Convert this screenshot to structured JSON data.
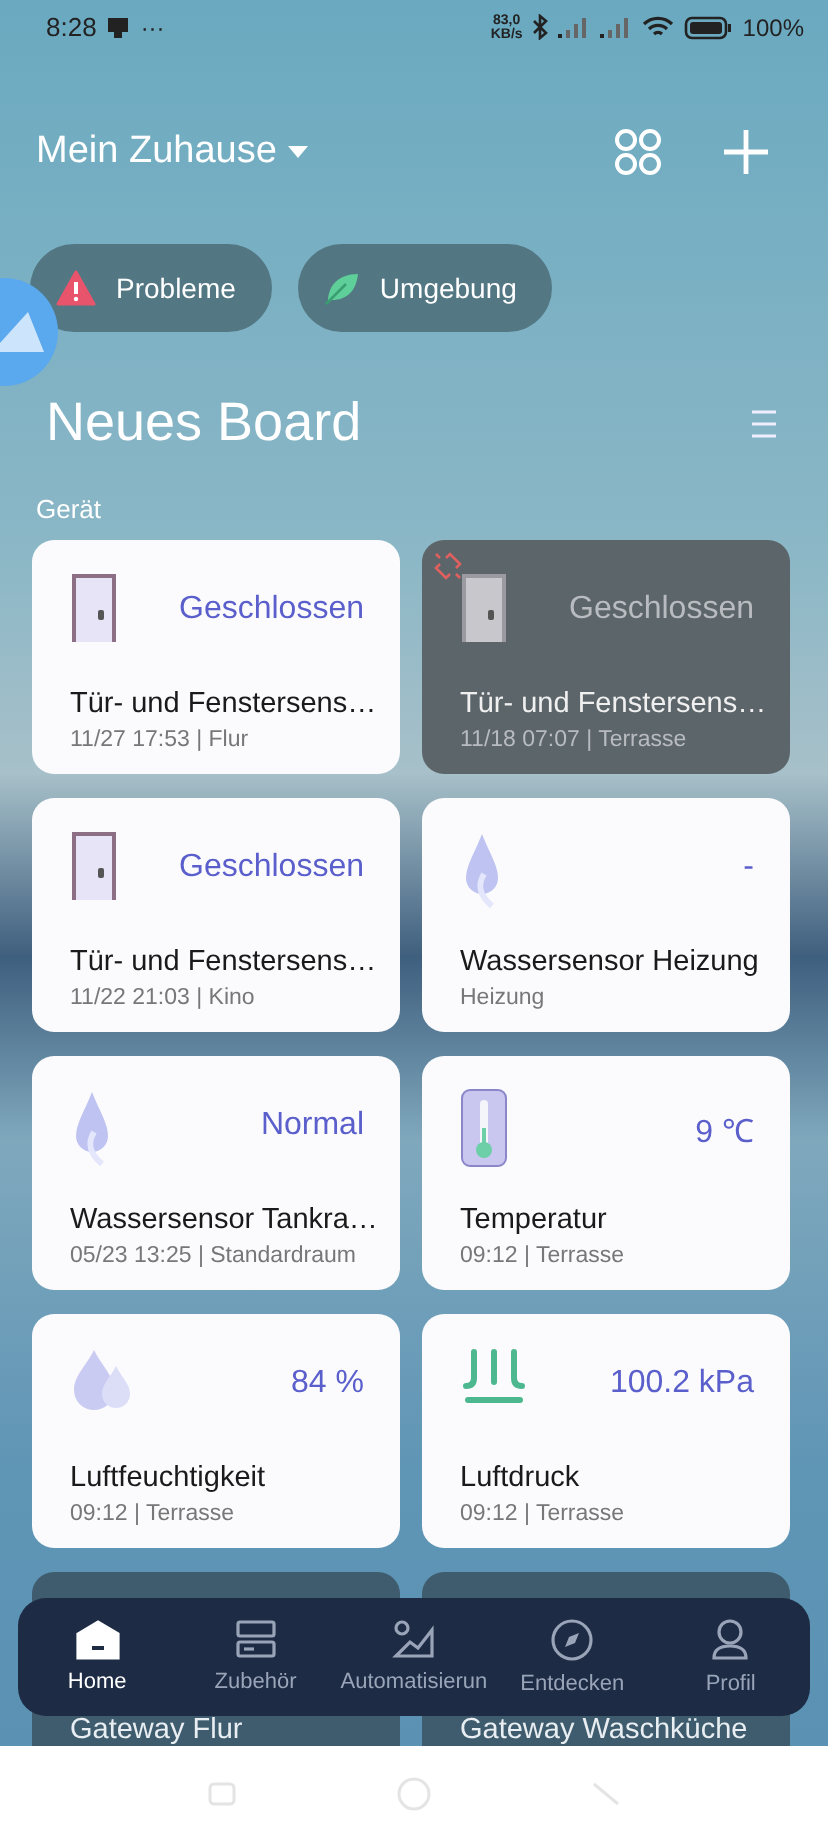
{
  "status_bar": {
    "time": "8:28",
    "dots": "···",
    "speed": "83,0\nKB/s",
    "battery": "100%"
  },
  "header": {
    "home": "Mein Zuhause"
  },
  "chips": [
    {
      "kind": "warning",
      "label": "Probleme"
    },
    {
      "kind": "leaf",
      "label": "Umgebung"
    }
  ],
  "board": {
    "title": "Neues Board"
  },
  "section": "Gerät",
  "devices": [
    {
      "kind": "door",
      "value": "Geschlossen",
      "name": "Tür- und Fenstersens…",
      "meta": "11/27 17:53 | Flur",
      "offline": false
    },
    {
      "kind": "door",
      "value": "Geschlossen",
      "name": "Tür- und Fenstersens…",
      "meta": "11/18 07:07 | Terrasse",
      "offline": true
    },
    {
      "kind": "door",
      "value": "Geschlossen",
      "name": "Tür- und Fenstersens…",
      "meta": "11/22 21:03 | Kino",
      "offline": false
    },
    {
      "kind": "water",
      "value": "-",
      "name": "Wassersensor Heizung",
      "meta": "Heizung",
      "offline": false
    },
    {
      "kind": "water",
      "value": "Normal",
      "name": "Wassersensor Tankra…",
      "meta": "05/23 13:25 | Standardraum",
      "offline": false
    },
    {
      "kind": "thermo",
      "value": "9 ℃",
      "name": "Temperatur",
      "meta": "09:12 | Terrasse",
      "offline": false
    },
    {
      "kind": "humidity",
      "value": "84 %",
      "name": "Luftfeuchtigkeit",
      "meta": "09:12 | Terrasse",
      "offline": false
    },
    {
      "kind": "pressure",
      "value": "100.2 kPa",
      "name": "Luftdruck",
      "meta": "09:12 | Terrasse",
      "offline": false
    }
  ],
  "gateways": [
    {
      "name": "Gateway Flur"
    },
    {
      "name": "Gateway Waschküche"
    }
  ],
  "nav": [
    {
      "kind": "home",
      "label": "Home",
      "selected": true
    },
    {
      "kind": "accessory",
      "label": "Zubehör",
      "selected": false
    },
    {
      "kind": "automation",
      "label": "Automatisierun",
      "selected": false
    },
    {
      "kind": "discover",
      "label": "Entdecken",
      "selected": false
    },
    {
      "kind": "profile",
      "label": "Profil",
      "selected": false
    }
  ]
}
